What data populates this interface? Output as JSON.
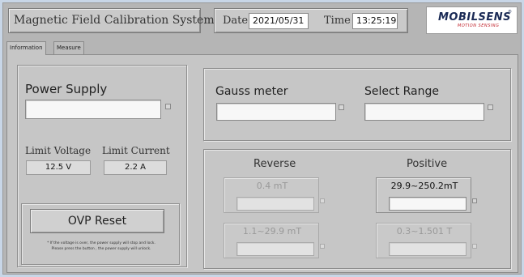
{
  "header": {
    "app_title": "Magnetic Field Calibration System",
    "date_label": "Date",
    "date_value": "2021/05/31",
    "time_label": "Time",
    "time_value": "13:25:19",
    "logo_text": "MOBILSENS",
    "logo_sub": "MOTION SENSING",
    "logo_mark": "®"
  },
  "tabs": [
    {
      "label": "Information",
      "active": true
    },
    {
      "label": "Measure",
      "active": false
    }
  ],
  "power_supply": {
    "label": "Power Supply",
    "value": "",
    "limit_voltage_label": "Limit Voltage",
    "limit_voltage_value": "12.5 V",
    "limit_current_label": "Limit Current",
    "limit_current_value": "2.2 A",
    "ovp_button": "OVP Reset",
    "note_line1": "* If the voltage is over, the power supply will stop and lock.",
    "note_line2": "Please press the button , the power supply will unlock."
  },
  "gauss": {
    "gauss_label": "Gauss meter",
    "gauss_value": "",
    "range_label": "Select Range",
    "range_value": ""
  },
  "ranges": {
    "reverse_label": "Reverse",
    "positive_label": "Positive",
    "reverse_items": [
      {
        "title": "0.4 mT",
        "value": "",
        "enabled": false
      },
      {
        "title": "1.1~29.9 mT",
        "value": "",
        "enabled": false
      }
    ],
    "positive_items": [
      {
        "title": "29.9~250.2mT",
        "value": "",
        "enabled": true
      },
      {
        "title": "0.3~1.501 T",
        "value": "",
        "enabled": false
      }
    ]
  },
  "colors": {
    "window_bg": "#b5b5b5",
    "panel_bg": "#c6c6c6",
    "logo_blue": "#1a2a55",
    "logo_red": "#c0222a",
    "disabled_text": "#999999"
  }
}
